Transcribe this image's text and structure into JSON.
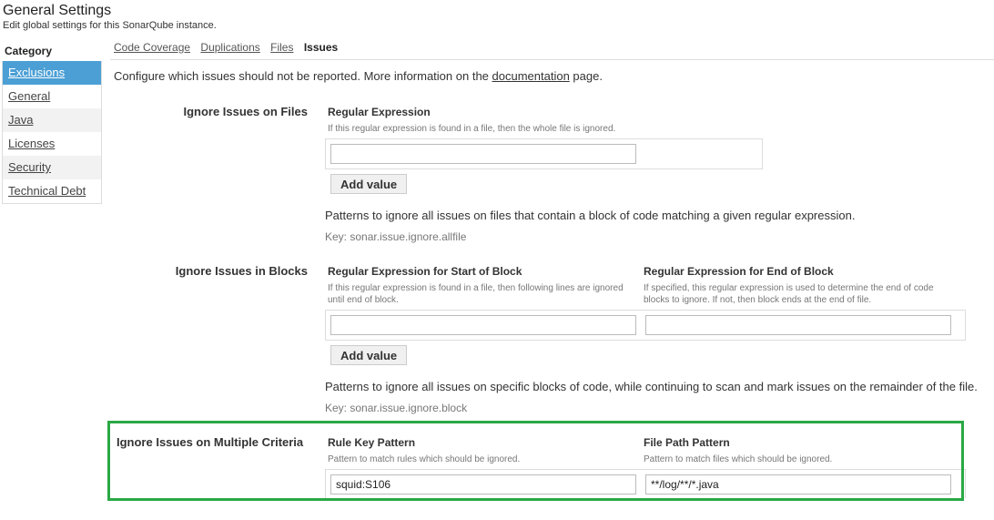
{
  "header": {
    "title": "General Settings",
    "description": "Edit global settings for this SonarQube instance."
  },
  "sidebar": {
    "heading": "Category",
    "items": [
      {
        "label": "Exclusions",
        "selected": true
      },
      {
        "label": "General",
        "selected": false
      },
      {
        "label": "Java",
        "selected": false
      },
      {
        "label": "Licenses",
        "selected": false
      },
      {
        "label": "Security",
        "selected": false
      },
      {
        "label": "Technical Debt",
        "selected": false
      }
    ]
  },
  "tabs": [
    {
      "label": "Code Coverage",
      "active": false
    },
    {
      "label": "Duplications",
      "active": false
    },
    {
      "label": "Files",
      "active": false
    },
    {
      "label": "Issues",
      "active": true
    }
  ],
  "intro": {
    "before": "Configure which issues should not be reported. More information on the ",
    "link": "documentation",
    "after": " page."
  },
  "sections": {
    "files": {
      "label": "Ignore Issues on Files",
      "field_title": "Regular Expression",
      "field_help": "If this regular expression is found in a file, then the whole file is ignored.",
      "value": "",
      "add_label": "Add value",
      "description": "Patterns to ignore all issues on files that contain a block of code matching a given regular expression.",
      "key": "Key: sonar.issue.ignore.allfile"
    },
    "blocks": {
      "label": "Ignore Issues in Blocks",
      "start_title": "Regular Expression for Start of Block",
      "start_help": "If this regular expression is found in a file, then following lines are ignored until end of block.",
      "end_title": "Regular Expression for End of Block",
      "end_help": "If specified, this regular expression is used to determine the end of code blocks to ignore. If not, then block ends at the end of file.",
      "start_value": "",
      "end_value": "",
      "add_label": "Add value",
      "description": "Patterns to ignore all issues on specific blocks of code, while continuing to scan and mark issues on the remainder of the file.",
      "key": "Key: sonar.issue.ignore.block"
    },
    "multicriteria": {
      "label": "Ignore Issues on Multiple Criteria",
      "rule_title": "Rule Key Pattern",
      "rule_help": "Pattern to match rules which should be ignored.",
      "path_title": "File Path Pattern",
      "path_help": "Pattern to match files which should be ignored.",
      "rule_value": "squid:S106",
      "path_value": "**/log/**/*.java"
    }
  },
  "colors": {
    "selected_category": "#4b9fd5",
    "highlight_border": "#2aa845"
  }
}
